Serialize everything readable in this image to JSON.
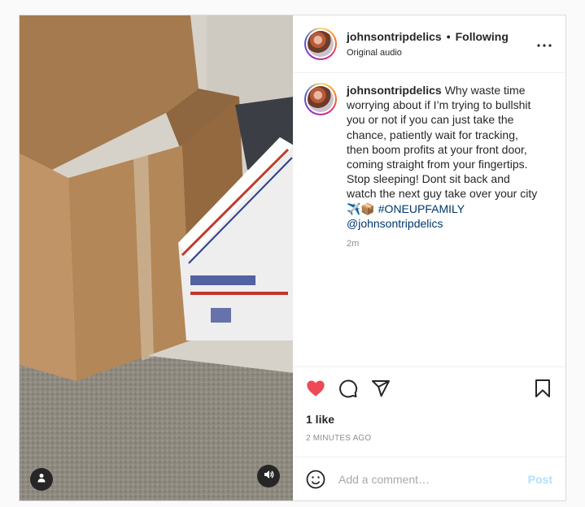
{
  "post": {
    "username": "johnsontripdelics",
    "separator": "•",
    "follow_status": "Following",
    "audio_label": "Original audio"
  },
  "caption": {
    "username": "johnsontripdelics",
    "text": "Why waste time worrying about if I’m trying to bullshit you or not if you can just take the chance, patiently wait for tracking, then boom profits at your front door, coming straight from your fingertips. Stop sleeping! Dont sit back and watch the next guy take over your city ✈️📦",
    "hashtag": "#ONEUPFAMILY",
    "mention": "@johnsontripdelics",
    "time": "2m"
  },
  "engagement": {
    "likes": "1 like",
    "timestamp": "2 MINUTES AGO",
    "liked": true
  },
  "comment_box": {
    "placeholder": "Add a comment…",
    "post_label": "Post"
  },
  "icons": {
    "like": "heart-icon",
    "comment": "comment-icon",
    "share": "share-icon",
    "save": "bookmark-icon",
    "more": "more-options-icon",
    "emoji": "emoji-icon",
    "user_tag": "user-icon",
    "audio": "speaker-icon"
  },
  "colors": {
    "like_red": "#ed4956",
    "link_blue": "#00376b",
    "post_button": "#b2dffc",
    "muted_gray": "#8e8e8e"
  }
}
